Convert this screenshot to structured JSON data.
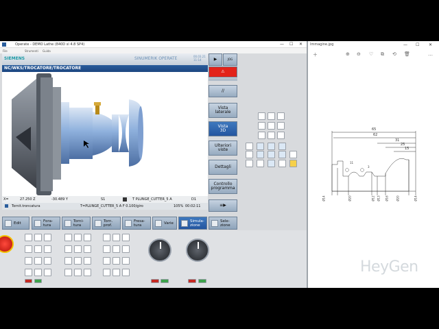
{
  "window": {
    "title": "Operate - DEMO Lathe (840D sl 4.8 SP4)",
    "menu": [
      "File",
      "Strumenti",
      "Guida"
    ],
    "controls": [
      "—",
      "☐",
      "✕"
    ]
  },
  "hmi": {
    "brand": "SIEMENS",
    "product": "SINUMERIK OPERATE",
    "version_line1": "00.03.21",
    "version_line2": "11:14",
    "path": "NC/WKS/TROCATORE/TROCATORE"
  },
  "status": {
    "x_label": "X=",
    "x_value": "27.250 Z",
    "y_value": "-30.489 Y",
    "spindle": "S1",
    "tool": "T PLUNGE_CUTTER_5 A",
    "d": "D1"
  },
  "program": {
    "name": "Tornit.troncatura",
    "line": "T=PLUNGE_CUTTER_5 A F 0.100/giro",
    "override": "105%",
    "time": "00:02:11"
  },
  "bottom_softkeys": [
    {
      "label": "Edit"
    },
    {
      "label": "Fora-\ntura"
    },
    {
      "label": "Torni-\ntura"
    },
    {
      "label": "Torn.\nprof."
    },
    {
      "label": "Fresa-\ntura"
    },
    {
      "label": "Varie"
    },
    {
      "label": "Simula-\nzione"
    },
    {
      "label": "Sele-\nzione"
    }
  ],
  "right_softkeys": {
    "jog": "JOG",
    "vista_laterale": "Vista\nlaterale",
    "vista_3d": "Vista\n3D",
    "ulteriori_viste": "Ulteriori\nviste",
    "dettagli": "Dettagli",
    "controllo_programma": "Controllo\nprogramma"
  },
  "viewer": {
    "filename": "Immagine.jpg",
    "dims": [
      "65",
      "62",
      "31",
      "25",
      "15",
      "11",
      "3"
    ],
    "diameters": [
      "Ø14",
      "Ø20",
      "Ø12",
      "Ø13",
      "Ø16",
      "Ø20",
      "Ø14"
    ],
    "tools": [
      "＋",
      "⊕",
      "⊖",
      "♡",
      "⧉",
      "⟲",
      "🗑",
      "…"
    ],
    "controls": [
      "—",
      "☐",
      "✕"
    ]
  },
  "watermark": "HeyGen",
  "colors": {
    "accent_blue": "#2456a0",
    "siemens_teal": "#1b9aa5",
    "estop_red": "#d01a10"
  }
}
